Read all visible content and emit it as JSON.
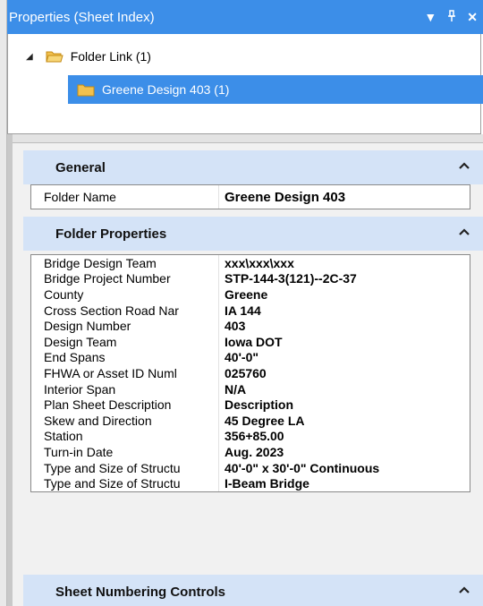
{
  "panel": {
    "title": "Properties (Sheet Index)",
    "controls": {
      "dropdown_glyph": "▼",
      "pin_glyph": "ᛘ",
      "close_glyph": "✕"
    }
  },
  "tree": {
    "items": [
      {
        "label": "Folder Link (1)",
        "icon": "open-folder-icon",
        "expanded": true,
        "selected": false
      },
      {
        "label": "Greene Design 403 (1)",
        "icon": "folder-icon",
        "selected": true
      }
    ]
  },
  "sections": {
    "general": {
      "title": "General",
      "rows": [
        {
          "key": "Folder Name",
          "value": "Greene Design 403"
        }
      ]
    },
    "folder_properties": {
      "title": "Folder Properties",
      "rows": [
        {
          "key": "Bridge Design Team",
          "value": "xxx\\xxx\\xxx"
        },
        {
          "key": "Bridge Project Number",
          "value": "STP-144-3(121)--2C-37"
        },
        {
          "key": "County",
          "value": "Greene"
        },
        {
          "key": "Cross Section Road Nar",
          "value": "IA 144"
        },
        {
          "key": "Design Number",
          "value": "403"
        },
        {
          "key": "Design Team",
          "value": "Iowa DOT"
        },
        {
          "key": "End Spans",
          "value": "40'-0\""
        },
        {
          "key": "FHWA or Asset ID Numl",
          "value": "025760"
        },
        {
          "key": "Interior Span",
          "value": "N/A"
        },
        {
          "key": "Plan Sheet Description",
          "value": "Description"
        },
        {
          "key": "Skew and Direction",
          "value": "45 Degree LA"
        },
        {
          "key": "Station",
          "value": "356+85.00"
        },
        {
          "key": "Turn-in Date",
          "value": "Aug. 2023"
        },
        {
          "key": "Type and Size of Structu",
          "value": "40'-0\" x 30'-0\" Continuous"
        },
        {
          "key": "Type and Size of Structu",
          "value": "I-Beam Bridge"
        }
      ]
    },
    "sheet_numbering": {
      "title": "Sheet Numbering Controls"
    }
  },
  "colors": {
    "accent": "#3c8ee8",
    "section_header": "#d4e3f7",
    "panel_bg": "#f1f1f1"
  }
}
